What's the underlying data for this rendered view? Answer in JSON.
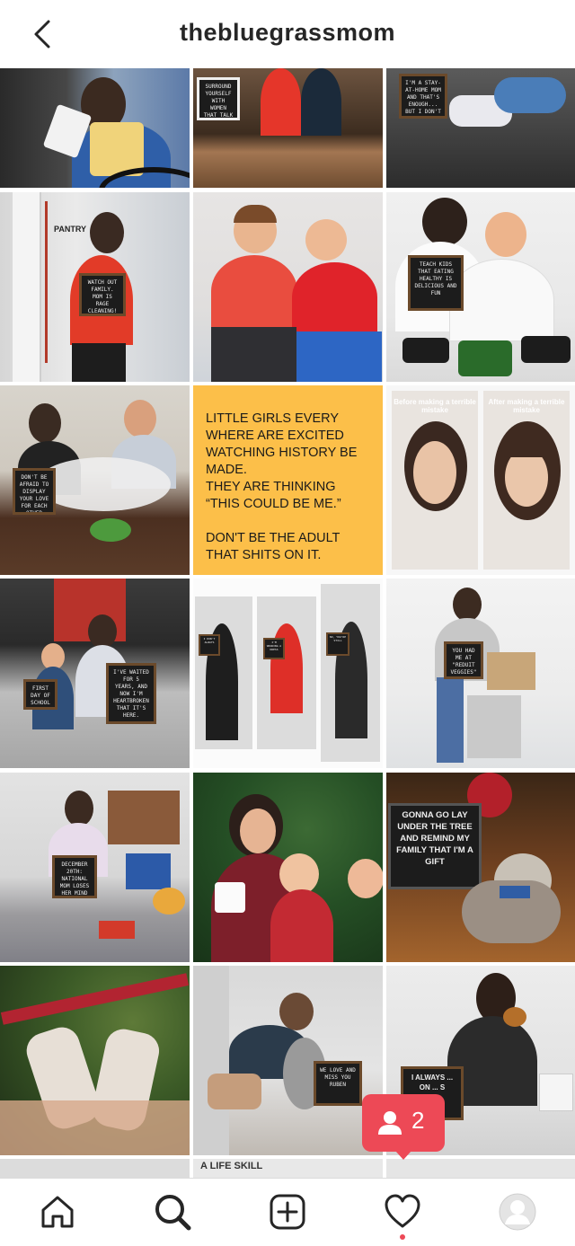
{
  "header": {
    "title": "thebluegrassmom",
    "back_icon": "chevron-left-icon"
  },
  "posts": [
    {
      "id": 1,
      "board": ""
    },
    {
      "id": 2,
      "board": "SURROUND YOURSELF WITH WOMEN THAT TALK ABOUT IDEAS. NOT PEOPLE."
    },
    {
      "id": 3,
      "board": "I'M A STAY-AT-HOME MOM AND THAT'S ENOUGH... BUT I DON'T ALWAYS BELIEVE IT"
    },
    {
      "id": 4,
      "board": "WATCH OUT FAMILY. MOM IS RAGE CLEANING!",
      "sign": "PANTRY"
    },
    {
      "id": 5,
      "board": ""
    },
    {
      "id": 6,
      "board": "TEACH KIDS THAT EATING HEALTHY IS DELICIOUS AND FUN"
    },
    {
      "id": 7,
      "board": "DON'T BE AFRAID TO DISPLAY YOUR LOVE FOR EACH OTHER BECAUSE YOUR KIDS ARE WATCHING"
    },
    {
      "id": 8,
      "quote": "LITTLE GIRLS EVERY\nWHERE ARE EXCITED\nWATCHING HISTORY BE\nMADE.\nTHEY ARE THINKING\n“THIS COULD BE ME.”\n\nDON'T BE THE ADULT\nTHAT SHITS ON IT."
    },
    {
      "id": 9,
      "caption_left": "Before making a terrible mistake",
      "caption_right": "After making a terrible mistake"
    },
    {
      "id": 10,
      "board": "FIRST DAY OF SCHOOL",
      "board2": "I'VE WAITED FOR 5 YEARS, AND NOW I'M HEARTBROKEN THAT IT'S HERE."
    },
    {
      "id": 11,
      "boards": [
        "I DON'T ALWAYS",
        "I'M WEARING A DRESS",
        "NO, YOU'RE STILL"
      ]
    },
    {
      "id": 12,
      "board": "YOU HAD ME AT \"REDUIT VEGGIES\""
    },
    {
      "id": 13,
      "board": "DECEMBER 20TH: NATIONAL MOM LOSES HER MIND OVER THE HOUSE DAY"
    },
    {
      "id": 14,
      "board": ""
    },
    {
      "id": 15,
      "board": "GONNA GO LAY UNDER THE TREE AND REMIND MY FAMILY THAT I'M A GIFT"
    },
    {
      "id": 16,
      "board": ""
    },
    {
      "id": 17,
      "board": "WE LOVE AND MISS YOU RUBEN"
    },
    {
      "id": 18,
      "board": "I ALWAYS ... ON ... S"
    },
    {
      "id": 19,
      "board": ""
    },
    {
      "id": 20,
      "board": "A LIFE SKILL"
    },
    {
      "id": 21,
      "board": ""
    }
  ],
  "notification": {
    "icon": "person-icon",
    "count": "2"
  },
  "tabbar": {
    "items": [
      "home-icon",
      "search-icon",
      "add-post-icon",
      "heart-icon",
      "profile-avatar"
    ],
    "active": "search-icon",
    "accent": "#262626",
    "badge_color": "#ed4956"
  }
}
